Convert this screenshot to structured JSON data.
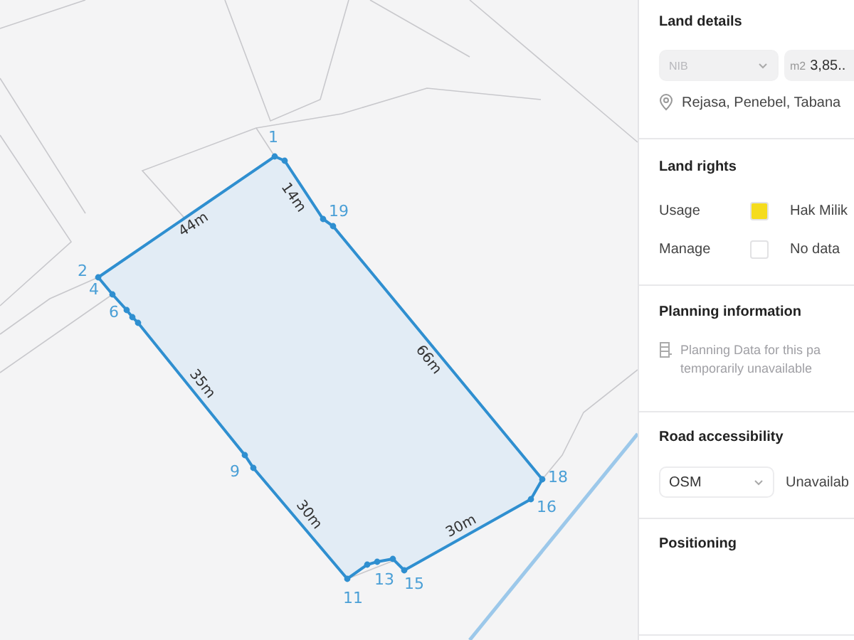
{
  "map": {
    "vertices": [
      {
        "label": "1"
      },
      {
        "label": "19"
      },
      {
        "label": "18"
      },
      {
        "label": "16"
      },
      {
        "label": "15"
      },
      {
        "label": "13"
      },
      {
        "label": "11"
      },
      {
        "label": "9"
      },
      {
        "label": "6"
      },
      {
        "label": "4"
      },
      {
        "label": "2"
      }
    ],
    "edges": [
      {
        "label": "44m"
      },
      {
        "label": "14m"
      },
      {
        "label": "66m"
      },
      {
        "label": "35m"
      },
      {
        "label": "30m"
      },
      {
        "label": "30m"
      }
    ]
  },
  "panel": {
    "land_details": {
      "title": "Land details",
      "id_select": {
        "value": "NIB",
        "disabled": true
      },
      "area_field": {
        "unit": "m2",
        "value": "3,85.."
      },
      "location": "Rejasa, Penebel, Tabana"
    },
    "land_rights": {
      "title": "Land rights",
      "rows": [
        {
          "label": "Usage",
          "value": "Hak Milik",
          "color": "#f5dc1e"
        },
        {
          "label": "Manage",
          "value": "No data",
          "color": "#ffffff"
        }
      ]
    },
    "planning": {
      "title": "Planning information",
      "message": "Planning Data for this pa",
      "message_line_2": "temporarily unavailable"
    },
    "road": {
      "title": "Road accessibility",
      "source_select": {
        "value": "OSM",
        "disabled": false
      },
      "status": "Unavailab"
    },
    "positioning": {
      "title": "Positioning"
    }
  }
}
